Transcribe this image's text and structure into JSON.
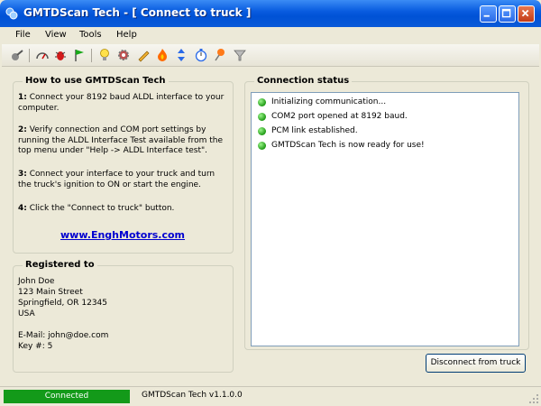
{
  "window": {
    "title": "GMTDScan Tech - [ Connect to truck ]",
    "icons": [
      "app-icon",
      "minimize-icon",
      "maximize-icon",
      "close-icon"
    ]
  },
  "menu": {
    "items": [
      "File",
      "View",
      "Tools",
      "Help"
    ]
  },
  "toolbar": {
    "icons": [
      "connect-truck-icon",
      "gauge-icon",
      "bug-icon",
      "flag-icon",
      "lightbulb-icon",
      "settings-gear-icon",
      "pencil-icon",
      "fire-icon",
      "arrows-icon",
      "timer-icon",
      "pin-icon",
      "filter-icon"
    ]
  },
  "howto": {
    "title": "How to use GMTDScan Tech",
    "steps": [
      {
        "num": "1:",
        "text": " Connect your 8192 baud ALDL interface to your computer."
      },
      {
        "num": "2:",
        "text": " Verify connection and COM port settings by running the ALDL Interface Test available from the top menu under \"Help -> ALDL Interface test\"."
      },
      {
        "num": "3:",
        "text": " Connect your interface to your truck and turn the truck's ignition to ON or start the engine."
      },
      {
        "num": "4:",
        "text": " Click the \"Connect to truck\" button."
      }
    ],
    "link": "www.EnghMotors.com"
  },
  "registered": {
    "title": "Registered to",
    "name": "John Doe",
    "street": "123 Main Street",
    "city": "Springfield, OR 12345",
    "country": "USA",
    "email": "E-Mail: john@doe.com",
    "key": "Key #: 5"
  },
  "connection": {
    "title": "Connection status",
    "items": [
      "Initializing communication...",
      "COM2 port opened at 8192 baud.",
      "PCM link established.",
      "GMTDScan Tech is now ready for use!"
    ],
    "dot_color": "#1f9a15"
  },
  "disconnect_label": "Disconnect from truck",
  "statusbar": {
    "connected": "Connected",
    "connected_color": "#139a19",
    "version": "GMTDScan Tech v1.1.0.0"
  }
}
